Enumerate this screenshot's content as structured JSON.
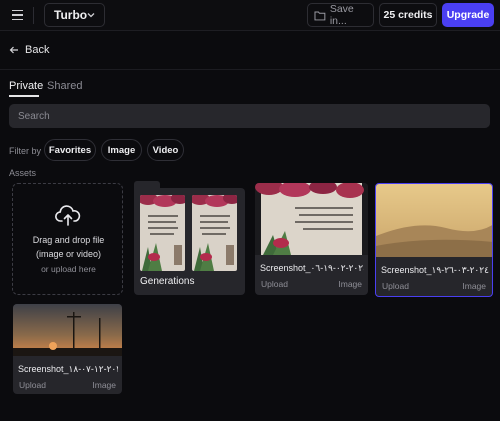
{
  "header": {
    "model": "Turbo",
    "save_label": "Save in...",
    "credits_label": "25 credits",
    "upgrade_label": "Upgrade"
  },
  "nav": {
    "back_label": "Back"
  },
  "tabs": {
    "private": "Private",
    "shared": "Shared"
  },
  "search": {
    "placeholder": "Search"
  },
  "filter": {
    "label": "Filter by",
    "chips": [
      "Favorites",
      "Image",
      "Video"
    ]
  },
  "assets": {
    "label": "Assets",
    "upload": {
      "line1": "Drag and drop file",
      "line2": "(image or video)",
      "line3": "or upload here"
    },
    "folder": {
      "name": "Generations"
    },
    "items": [
      {
        "name": "Screenshot_٢٠٢٤-٠٢-١٩-٠٦...",
        "source": "Upload",
        "type": "Image"
      },
      {
        "name": "Screenshot_٢٠٢٤-٠٣-٢٦-١٩...",
        "source": "Upload",
        "type": "Image"
      },
      {
        "name": "Screenshot_٢٠٢٣-١٢-٠٧-١٨-...",
        "source": "Upload",
        "type": "Image"
      }
    ]
  },
  "colors": {
    "accent": "#4a3ff2",
    "background": "#0b0b0e",
    "card": "#26262b"
  }
}
